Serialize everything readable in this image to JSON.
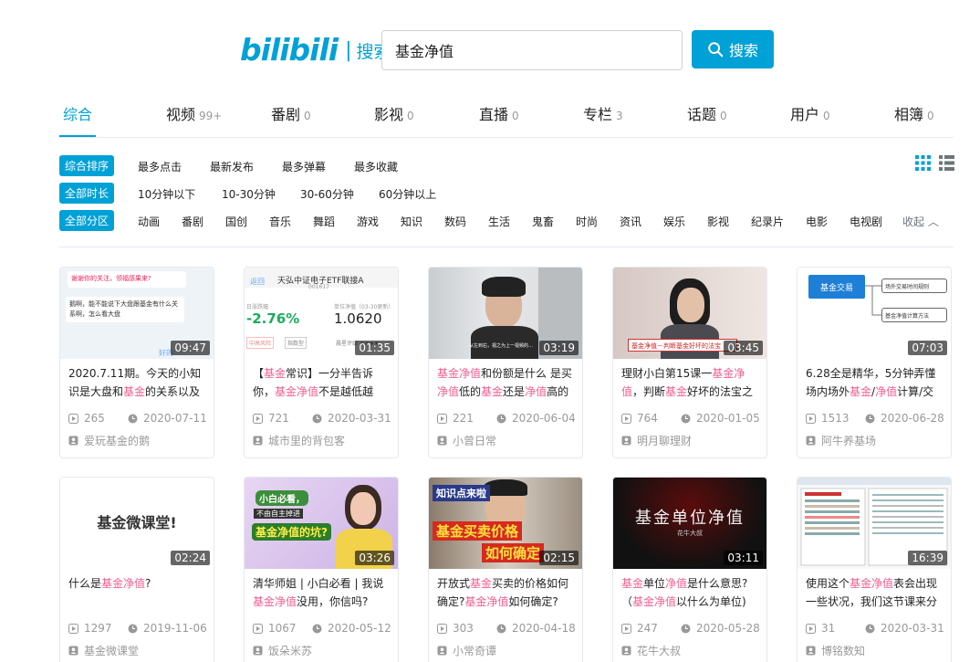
{
  "header": {
    "logo": "bilibili",
    "logo_sub": "搜索",
    "search_value": "基金净值",
    "search_button": "搜索"
  },
  "tabs": [
    {
      "label": "综合",
      "count": ""
    },
    {
      "label": "视频",
      "count": "99+"
    },
    {
      "label": "番剧",
      "count": "0"
    },
    {
      "label": "影视",
      "count": "0"
    },
    {
      "label": "直播",
      "count": "0"
    },
    {
      "label": "专栏",
      "count": "3"
    },
    {
      "label": "话题",
      "count": "0"
    },
    {
      "label": "用户",
      "count": "0"
    },
    {
      "label": "相簿",
      "count": "0"
    }
  ],
  "filters": {
    "sort": {
      "active": "综合排序",
      "options": [
        "最多点击",
        "最新发布",
        "最多弹幕",
        "最多收藏"
      ]
    },
    "duration": {
      "active": "全部时长",
      "options": [
        "10分钟以下",
        "10-30分钟",
        "30-60分钟",
        "60分钟以上"
      ]
    },
    "zone": {
      "active": "全部分区",
      "options": [
        "动画",
        "番剧",
        "国创",
        "音乐",
        "舞蹈",
        "游戏",
        "知识",
        "数码",
        "生活",
        "鬼畜",
        "时尚",
        "资讯",
        "娱乐",
        "影视",
        "纪录片",
        "电影",
        "电视剧"
      ],
      "collapse": "收起"
    }
  },
  "thumb_text": {
    "c1a": "谢谢你的关注，领福感果来?",
    "c1b": "鹅啊，能不能说下大盘跟基金有什么关系啊，怎么看大盘",
    "c1c": "好的",
    "c2_back": "返回",
    "c2_title": "天弘中证电子ETF联接A",
    "c2_code": "001617",
    "c2_l1": "日涨跌幅",
    "c2_l2": "单位净值（03-30更新）",
    "c2_v1": "-2.76%",
    "c2_v2": "1.0620",
    "c2_t1": "中高风险",
    "c2_t2": "指数型",
    "c2_t3": "晨星评级 ★★★★",
    "c3_overlay": "从左到右，视之为上一视频的…",
    "c4_banner": "基金净值－判断基金好坏的法宝",
    "c5_main": "基金交易",
    "c5_a": "场外交易时间规则",
    "c5_b": "基金净值计算方法",
    "c6_text": "基金微课堂!",
    "c7_l1": "小白必看，",
    "c7_l2": "不由自主掉进",
    "c7_l3": "基金净值的坑?",
    "c8_l1": "知识点来啦",
    "c8_l2": "基金买卖价格",
    "c8_l3": "如何确定",
    "c9_l1": "基金单位净值",
    "c9_l2": "花牛大叔"
  },
  "cards": [
    {
      "duration": "09:47",
      "title_parts": [
        [
          "2020.7.11期。今天的小知识是大盘和",
          ""
        ],
        [
          "基金",
          "hl"
        ],
        [
          "的关系以及",
          ""
        ]
      ],
      "views": "265",
      "date": "2020-07-11",
      "author": "爱玩基金的鹅"
    },
    {
      "duration": "01:35",
      "title_parts": [
        [
          "【",
          ""
        ],
        [
          "基金",
          "hl"
        ],
        [
          "常识】一分半告诉你，",
          ""
        ],
        [
          "基金净值",
          "hl"
        ],
        [
          "不是越低越",
          ""
        ]
      ],
      "views": "721",
      "date": "2020-03-31",
      "author": "城市里的背包客"
    },
    {
      "duration": "03:19",
      "title_parts": [
        [
          "基金净值",
          "hl"
        ],
        [
          "和份额是什么 是买",
          ""
        ],
        [
          "净值",
          "hl"
        ],
        [
          "低的",
          ""
        ],
        [
          "基金",
          "hl"
        ],
        [
          "还是",
          ""
        ],
        [
          "净值",
          "hl"
        ],
        [
          "高的",
          ""
        ]
      ],
      "views": "221",
      "date": "2020-06-04",
      "author": "小曾日常"
    },
    {
      "duration": "03:45",
      "title_parts": [
        [
          "理财小白第15课一",
          ""
        ],
        [
          "基金净",
          "hl"
        ],
        [
          "值",
          "hl"
        ],
        [
          "，判断",
          ""
        ],
        [
          "基金",
          "hl"
        ],
        [
          "好坏的法宝之",
          ""
        ]
      ],
      "views": "764",
      "date": "2020-01-05",
      "author": "明月聊理财"
    },
    {
      "duration": "07:03",
      "title_parts": [
        [
          "6.28全是精华，5分钟弄懂场内场外",
          ""
        ],
        [
          "基金",
          "hl"
        ],
        [
          "/",
          ""
        ],
        [
          "净值",
          "hl"
        ],
        [
          "计算/交",
          ""
        ]
      ],
      "views": "1513",
      "date": "2020-06-28",
      "author": "阿牛养基场"
    },
    {
      "duration": "02:24",
      "title_parts": [
        [
          "什么是",
          ""
        ],
        [
          "基金净值",
          "hl"
        ],
        [
          "?",
          ""
        ]
      ],
      "views": "1297",
      "date": "2019-11-06",
      "author": "基金微课堂"
    },
    {
      "duration": "03:26",
      "title_parts": [
        [
          "清华师姐 | 小白必看 | 我说",
          ""
        ],
        [
          "基金净值",
          "hl"
        ],
        [
          "没用，你信吗?",
          ""
        ]
      ],
      "views": "1067",
      "date": "2020-05-12",
      "author": "饭朵米苏"
    },
    {
      "duration": "02:15",
      "title_parts": [
        [
          "开放式",
          ""
        ],
        [
          "基金",
          "hl"
        ],
        [
          "买卖的价格如何确定?",
          ""
        ],
        [
          "基金净值",
          "hl"
        ],
        [
          "如何确定?",
          ""
        ]
      ],
      "views": "303",
      "date": "2020-04-18",
      "author": "小常奇谭"
    },
    {
      "duration": "03:11",
      "title_parts": [
        [
          "基金",
          "hl"
        ],
        [
          "单位",
          ""
        ],
        [
          "净值",
          "hl"
        ],
        [
          "是什么意思?（",
          ""
        ],
        [
          "基金净值",
          "hl"
        ],
        [
          "以什么为单位)",
          ""
        ]
      ],
      "views": "247",
      "date": "2020-05-28",
      "author": "花牛大叔"
    },
    {
      "duration": "16:39",
      "title_parts": [
        [
          "使用这个",
          ""
        ],
        [
          "基金净值",
          "hl"
        ],
        [
          "表会出现一些状况，我们这节课来分",
          ""
        ]
      ],
      "views": "31",
      "date": "2020-03-31",
      "author": "博铭数知"
    }
  ],
  "colors": {
    "accent": "#00a1d6",
    "highlight": "#f25d8e",
    "muted": "#999999"
  }
}
